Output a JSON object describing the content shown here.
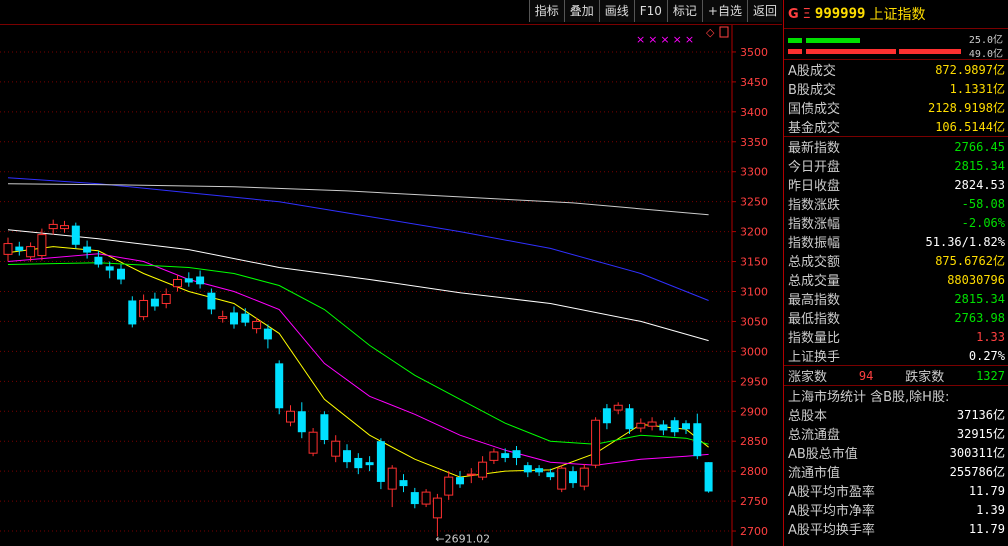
{
  "toolbar": {
    "items": [
      "指标",
      "叠加",
      "画线",
      "F10",
      "标记",
      "+自选",
      "返回"
    ]
  },
  "chart": {
    "y_ticks": [
      "3500",
      "3450",
      "3400",
      "3350",
      "3300",
      "3250",
      "3200",
      "3150",
      "3100",
      "3050",
      "3000",
      "2950",
      "2900",
      "2850",
      "2800",
      "2750",
      "2700"
    ],
    "low_label": "←2691.02",
    "marker_text": "×××××",
    "icons": [
      "diamond-icon",
      "window-icon"
    ]
  },
  "chart_data": {
    "type": "candlestick",
    "y_range": [
      2675,
      3545
    ],
    "candles": [
      {
        "o": 3162,
        "c": 3180,
        "h": 3190,
        "l": 3150
      },
      {
        "o": 3175,
        "c": 3168,
        "h": 3183,
        "l": 3160
      },
      {
        "o": 3158,
        "c": 3175,
        "h": 3182,
        "l": 3150
      },
      {
        "o": 3160,
        "c": 3195,
        "h": 3205,
        "l": 3152
      },
      {
        "o": 3205,
        "c": 3212,
        "h": 3220,
        "l": 3195
      },
      {
        "o": 3205,
        "c": 3210,
        "h": 3218,
        "l": 3198
      },
      {
        "o": 3210,
        "c": 3178,
        "h": 3215,
        "l": 3172
      },
      {
        "o": 3175,
        "c": 3165,
        "h": 3185,
        "l": 3155
      },
      {
        "o": 3158,
        "c": 3145,
        "h": 3168,
        "l": 3140
      },
      {
        "o": 3142,
        "c": 3135,
        "h": 3150,
        "l": 3122
      },
      {
        "o": 3138,
        "c": 3120,
        "h": 3145,
        "l": 3112
      },
      {
        "o": 3085,
        "c": 3045,
        "h": 3092,
        "l": 3040
      },
      {
        "o": 3058,
        "c": 3085,
        "h": 3095,
        "l": 3052
      },
      {
        "o": 3088,
        "c": 3075,
        "h": 3098,
        "l": 3068
      },
      {
        "o": 3080,
        "c": 3095,
        "h": 3105,
        "l": 3072
      },
      {
        "o": 3108,
        "c": 3120,
        "h": 3128,
        "l": 3100
      },
      {
        "o": 3122,
        "c": 3115,
        "h": 3132,
        "l": 3108
      },
      {
        "o": 3125,
        "c": 3112,
        "h": 3135,
        "l": 3105
      },
      {
        "o": 3098,
        "c": 3070,
        "h": 3105,
        "l": 3062
      },
      {
        "o": 3055,
        "c": 3058,
        "h": 3068,
        "l": 3048
      },
      {
        "o": 3065,
        "c": 3045,
        "h": 3075,
        "l": 3038
      },
      {
        "o": 3063,
        "c": 3048,
        "h": 3072,
        "l": 3042
      },
      {
        "o": 3038,
        "c": 3050,
        "h": 3056,
        "l": 3030
      },
      {
        "o": 3038,
        "c": 3020,
        "h": 3045,
        "l": 3005
      },
      {
        "o": 2980,
        "c": 2905,
        "h": 2985,
        "l": 2895
      },
      {
        "o": 2882,
        "c": 2900,
        "h": 2910,
        "l": 2875
      },
      {
        "o": 2900,
        "c": 2865,
        "h": 2915,
        "l": 2855
      },
      {
        "o": 2830,
        "c": 2865,
        "h": 2872,
        "l": 2825
      },
      {
        "o": 2895,
        "c": 2852,
        "h": 2900,
        "l": 2845
      },
      {
        "o": 2825,
        "c": 2850,
        "h": 2860,
        "l": 2815
      },
      {
        "o": 2835,
        "c": 2815,
        "h": 2845,
        "l": 2805
      },
      {
        "o": 2822,
        "c": 2805,
        "h": 2830,
        "l": 2795
      },
      {
        "o": 2815,
        "c": 2810,
        "h": 2825,
        "l": 2800
      },
      {
        "o": 2850,
        "c": 2782,
        "h": 2855,
        "l": 2770
      },
      {
        "o": 2770,
        "c": 2805,
        "h": 2810,
        "l": 2740
      },
      {
        "o": 2785,
        "c": 2775,
        "h": 2795,
        "l": 2765
      },
      {
        "o": 2765,
        "c": 2745,
        "h": 2772,
        "l": 2738
      },
      {
        "o": 2745,
        "c": 2765,
        "h": 2770,
        "l": 2740
      },
      {
        "o": 2722,
        "c": 2755,
        "h": 2762,
        "l": 2691
      },
      {
        "o": 2760,
        "c": 2790,
        "h": 2800,
        "l": 2752
      },
      {
        "o": 2790,
        "c": 2778,
        "h": 2800,
        "l": 2772
      },
      {
        "o": 2795,
        "c": 2795,
        "h": 2805,
        "l": 2780
      },
      {
        "o": 2790,
        "c": 2815,
        "h": 2825,
        "l": 2785
      },
      {
        "o": 2818,
        "c": 2832,
        "h": 2838,
        "l": 2812
      },
      {
        "o": 2830,
        "c": 2822,
        "h": 2838,
        "l": 2815
      },
      {
        "o": 2835,
        "c": 2822,
        "h": 2842,
        "l": 2810
      },
      {
        "o": 2810,
        "c": 2798,
        "h": 2815,
        "l": 2790
      },
      {
        "o": 2805,
        "c": 2798,
        "h": 2810,
        "l": 2792
      },
      {
        "o": 2798,
        "c": 2790,
        "h": 2804,
        "l": 2785
      },
      {
        "o": 2770,
        "c": 2805,
        "h": 2810,
        "l": 2765
      },
      {
        "o": 2800,
        "c": 2780,
        "h": 2808,
        "l": 2772
      },
      {
        "o": 2775,
        "c": 2805,
        "h": 2812,
        "l": 2768
      },
      {
        "o": 2810,
        "c": 2885,
        "h": 2890,
        "l": 2805
      },
      {
        "o": 2905,
        "c": 2880,
        "h": 2912,
        "l": 2870
      },
      {
        "o": 2902,
        "c": 2910,
        "h": 2915,
        "l": 2895
      },
      {
        "o": 2905,
        "c": 2870,
        "h": 2912,
        "l": 2862
      },
      {
        "o": 2872,
        "c": 2880,
        "h": 2888,
        "l": 2865
      },
      {
        "o": 2875,
        "c": 2882,
        "h": 2890,
        "l": 2868
      },
      {
        "o": 2878,
        "c": 2868,
        "h": 2885,
        "l": 2860
      },
      {
        "o": 2885,
        "c": 2865,
        "h": 2890,
        "l": 2858
      },
      {
        "o": 2880,
        "c": 2870,
        "h": 2885,
        "l": 2862
      },
      {
        "o": 2880,
        "c": 2825,
        "h": 2896,
        "l": 2820
      },
      {
        "o": 2815,
        "c": 2766,
        "h": 2815,
        "l": 2764
      }
    ],
    "moving_averages": [
      {
        "color": "#ffffff",
        "points": [
          [
            0,
            3203
          ],
          [
            8,
            3188
          ],
          [
            16,
            3170
          ],
          [
            24,
            3140
          ],
          [
            32,
            3120
          ],
          [
            40,
            3098
          ],
          [
            48,
            3080
          ],
          [
            56,
            3050
          ],
          [
            62,
            3018
          ]
        ]
      },
      {
        "color": "#ffff00",
        "points": [
          [
            0,
            3165
          ],
          [
            4,
            3175
          ],
          [
            8,
            3168
          ],
          [
            12,
            3130
          ],
          [
            16,
            3100
          ],
          [
            20,
            3080
          ],
          [
            24,
            3030
          ],
          [
            28,
            2920
          ],
          [
            32,
            2860
          ],
          [
            36,
            2820
          ],
          [
            40,
            2790
          ],
          [
            44,
            2800
          ],
          [
            48,
            2802
          ],
          [
            52,
            2830
          ],
          [
            56,
            2878
          ],
          [
            60,
            2870
          ],
          [
            62,
            2840
          ]
        ]
      },
      {
        "color": "#ff00ff",
        "points": [
          [
            0,
            3150
          ],
          [
            8,
            3163
          ],
          [
            12,
            3150
          ],
          [
            16,
            3120
          ],
          [
            20,
            3100
          ],
          [
            24,
            3070
          ],
          [
            28,
            2980
          ],
          [
            32,
            2925
          ],
          [
            36,
            2895
          ],
          [
            40,
            2860
          ],
          [
            44,
            2835
          ],
          [
            48,
            2815
          ],
          [
            52,
            2810
          ],
          [
            56,
            2820
          ],
          [
            60,
            2825
          ],
          [
            62,
            2828
          ]
        ]
      },
      {
        "color": "#00ff00",
        "points": [
          [
            0,
            3145
          ],
          [
            8,
            3148
          ],
          [
            16,
            3140
          ],
          [
            20,
            3130
          ],
          [
            24,
            3110
          ],
          [
            28,
            3070
          ],
          [
            32,
            3010
          ],
          [
            36,
            2960
          ],
          [
            40,
            2920
          ],
          [
            44,
            2880
          ],
          [
            48,
            2850
          ],
          [
            52,
            2845
          ],
          [
            56,
            2860
          ],
          [
            60,
            2855
          ],
          [
            62,
            2845
          ]
        ]
      },
      {
        "color": "#3030ff",
        "points": [
          [
            0,
            3290
          ],
          [
            8,
            3280
          ],
          [
            16,
            3265
          ],
          [
            24,
            3250
          ],
          [
            32,
            3225
          ],
          [
            40,
            3200
          ],
          [
            48,
            3172
          ],
          [
            56,
            3130
          ],
          [
            62,
            3085
          ]
        ]
      },
      {
        "color": "#cccccc",
        "points": [
          [
            0,
            3280
          ],
          [
            10,
            3278
          ],
          [
            20,
            3275
          ],
          [
            30,
            3268
          ],
          [
            40,
            3258
          ],
          [
            50,
            3248
          ],
          [
            62,
            3228
          ]
        ]
      }
    ]
  },
  "panel": {
    "header": {
      "g": "G",
      "menu": "Ξ",
      "code": "999999",
      "name": "上证指数"
    },
    "bars": [
      {
        "value": "25.0亿",
        "color": "#00e000"
      },
      {
        "value": "49.0亿",
        "color": "#ff3030"
      }
    ],
    "rows1": [
      {
        "label": "A股成交",
        "value": "872.9897亿",
        "color": "#ffdd00"
      },
      {
        "label": "B股成交",
        "value": "1.1331亿",
        "color": "#ffdd00"
      },
      {
        "label": "国债成交",
        "value": "2128.9198亿",
        "color": "#ffdd00"
      },
      {
        "label": "基金成交",
        "value": "106.5144亿",
        "color": "#ffdd00"
      }
    ],
    "rows2": [
      {
        "label": "最新指数",
        "value": "2766.45",
        "color": "#00e000"
      },
      {
        "label": "今日开盘",
        "value": "2815.34",
        "color": "#00e000"
      },
      {
        "label": "昨日收盘",
        "value": "2824.53",
        "color": "#ffffff"
      },
      {
        "label": "指数涨跌",
        "value": "-58.08",
        "color": "#00e000"
      },
      {
        "label": "指数涨幅",
        "value": "-2.06%",
        "color": "#00e000"
      },
      {
        "label": "指数振幅",
        "value": "51.36/1.82%",
        "color": "#ffffff"
      },
      {
        "label": "总成交额",
        "value": "875.6762亿",
        "color": "#ffdd00"
      },
      {
        "label": "总成交量",
        "value": "88030796",
        "color": "#ffdd00"
      },
      {
        "label": "最高指数",
        "value": "2815.34",
        "color": "#00e000"
      },
      {
        "label": "最低指数",
        "value": "2763.98",
        "color": "#00e000"
      },
      {
        "label": "指数量比",
        "value": "1.33",
        "color": "#ff4040"
      },
      {
        "label": "上证换手",
        "value": "0.27%",
        "color": "#ffffff"
      }
    ],
    "updown": {
      "up_label": "涨家数",
      "up_value": "94",
      "down_label": "跌家数",
      "down_value": "1327"
    },
    "stats_title": "上海市场统计 含B股,除H股:",
    "rows3": [
      {
        "label": "总股本",
        "value": "37136亿",
        "color": "#ffffff"
      },
      {
        "label": "总流通盘",
        "value": "32915亿",
        "color": "#ffffff"
      },
      {
        "label": "AB股总市值",
        "value": "300311亿",
        "color": "#ffffff"
      },
      {
        "label": "流通市值",
        "value": "255786亿",
        "color": "#ffffff"
      },
      {
        "label": "A股平均市盈率",
        "value": "11.79",
        "color": "#ffffff"
      },
      {
        "label": "A股平均市净率",
        "value": "1.39",
        "color": "#ffffff"
      },
      {
        "label": "A股平均换手率",
        "value": "11.79",
        "color": "#ffffff"
      }
    ]
  }
}
